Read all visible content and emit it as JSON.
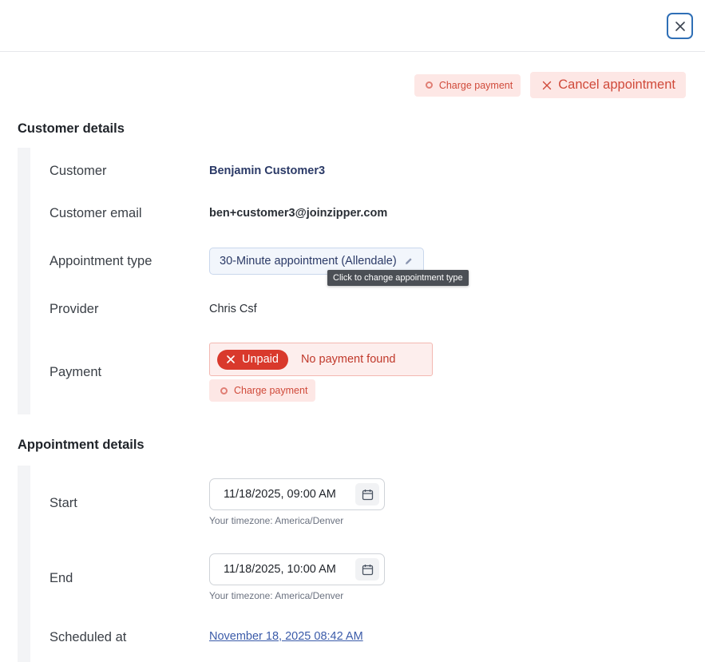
{
  "modal": {
    "close_icon": "close-icon"
  },
  "actions": {
    "charge_payment_label": "Charge payment",
    "cancel_appointment_label": "Cancel appointment"
  },
  "customer_details": {
    "title": "Customer details",
    "customer_label": "Customer",
    "customer_value": "Benjamin Customer3",
    "email_label": "Customer email",
    "email_value": "ben+customer3@joinzipper.com",
    "appointment_type_label": "Appointment type",
    "appointment_type_value": "30-Minute appointment (Allendale)",
    "appointment_type_tooltip": "Click to change appointment type",
    "provider_label": "Provider",
    "provider_value": "Chris Csf",
    "payment_label": "Payment",
    "payment_status": "Unpaid",
    "payment_message": "No payment found",
    "payment_charge_label": "Charge payment"
  },
  "appointment_details": {
    "title": "Appointment details",
    "start_label": "Start",
    "start_value": "11/18/2025, 09:00 AM",
    "start_timezone": "Your timezone: America/Denver",
    "end_label": "End",
    "end_value": "11/18/2025, 10:00 AM",
    "end_timezone": "Your timezone: America/Denver",
    "scheduled_label": "Scheduled at",
    "scheduled_value": "November 18, 2025 08:42 AM"
  },
  "colors": {
    "accent_blue": "#2f6fb6",
    "danger": "#d9392c",
    "danger_soft": "#fde7e5",
    "link": "#3b5ba9"
  }
}
